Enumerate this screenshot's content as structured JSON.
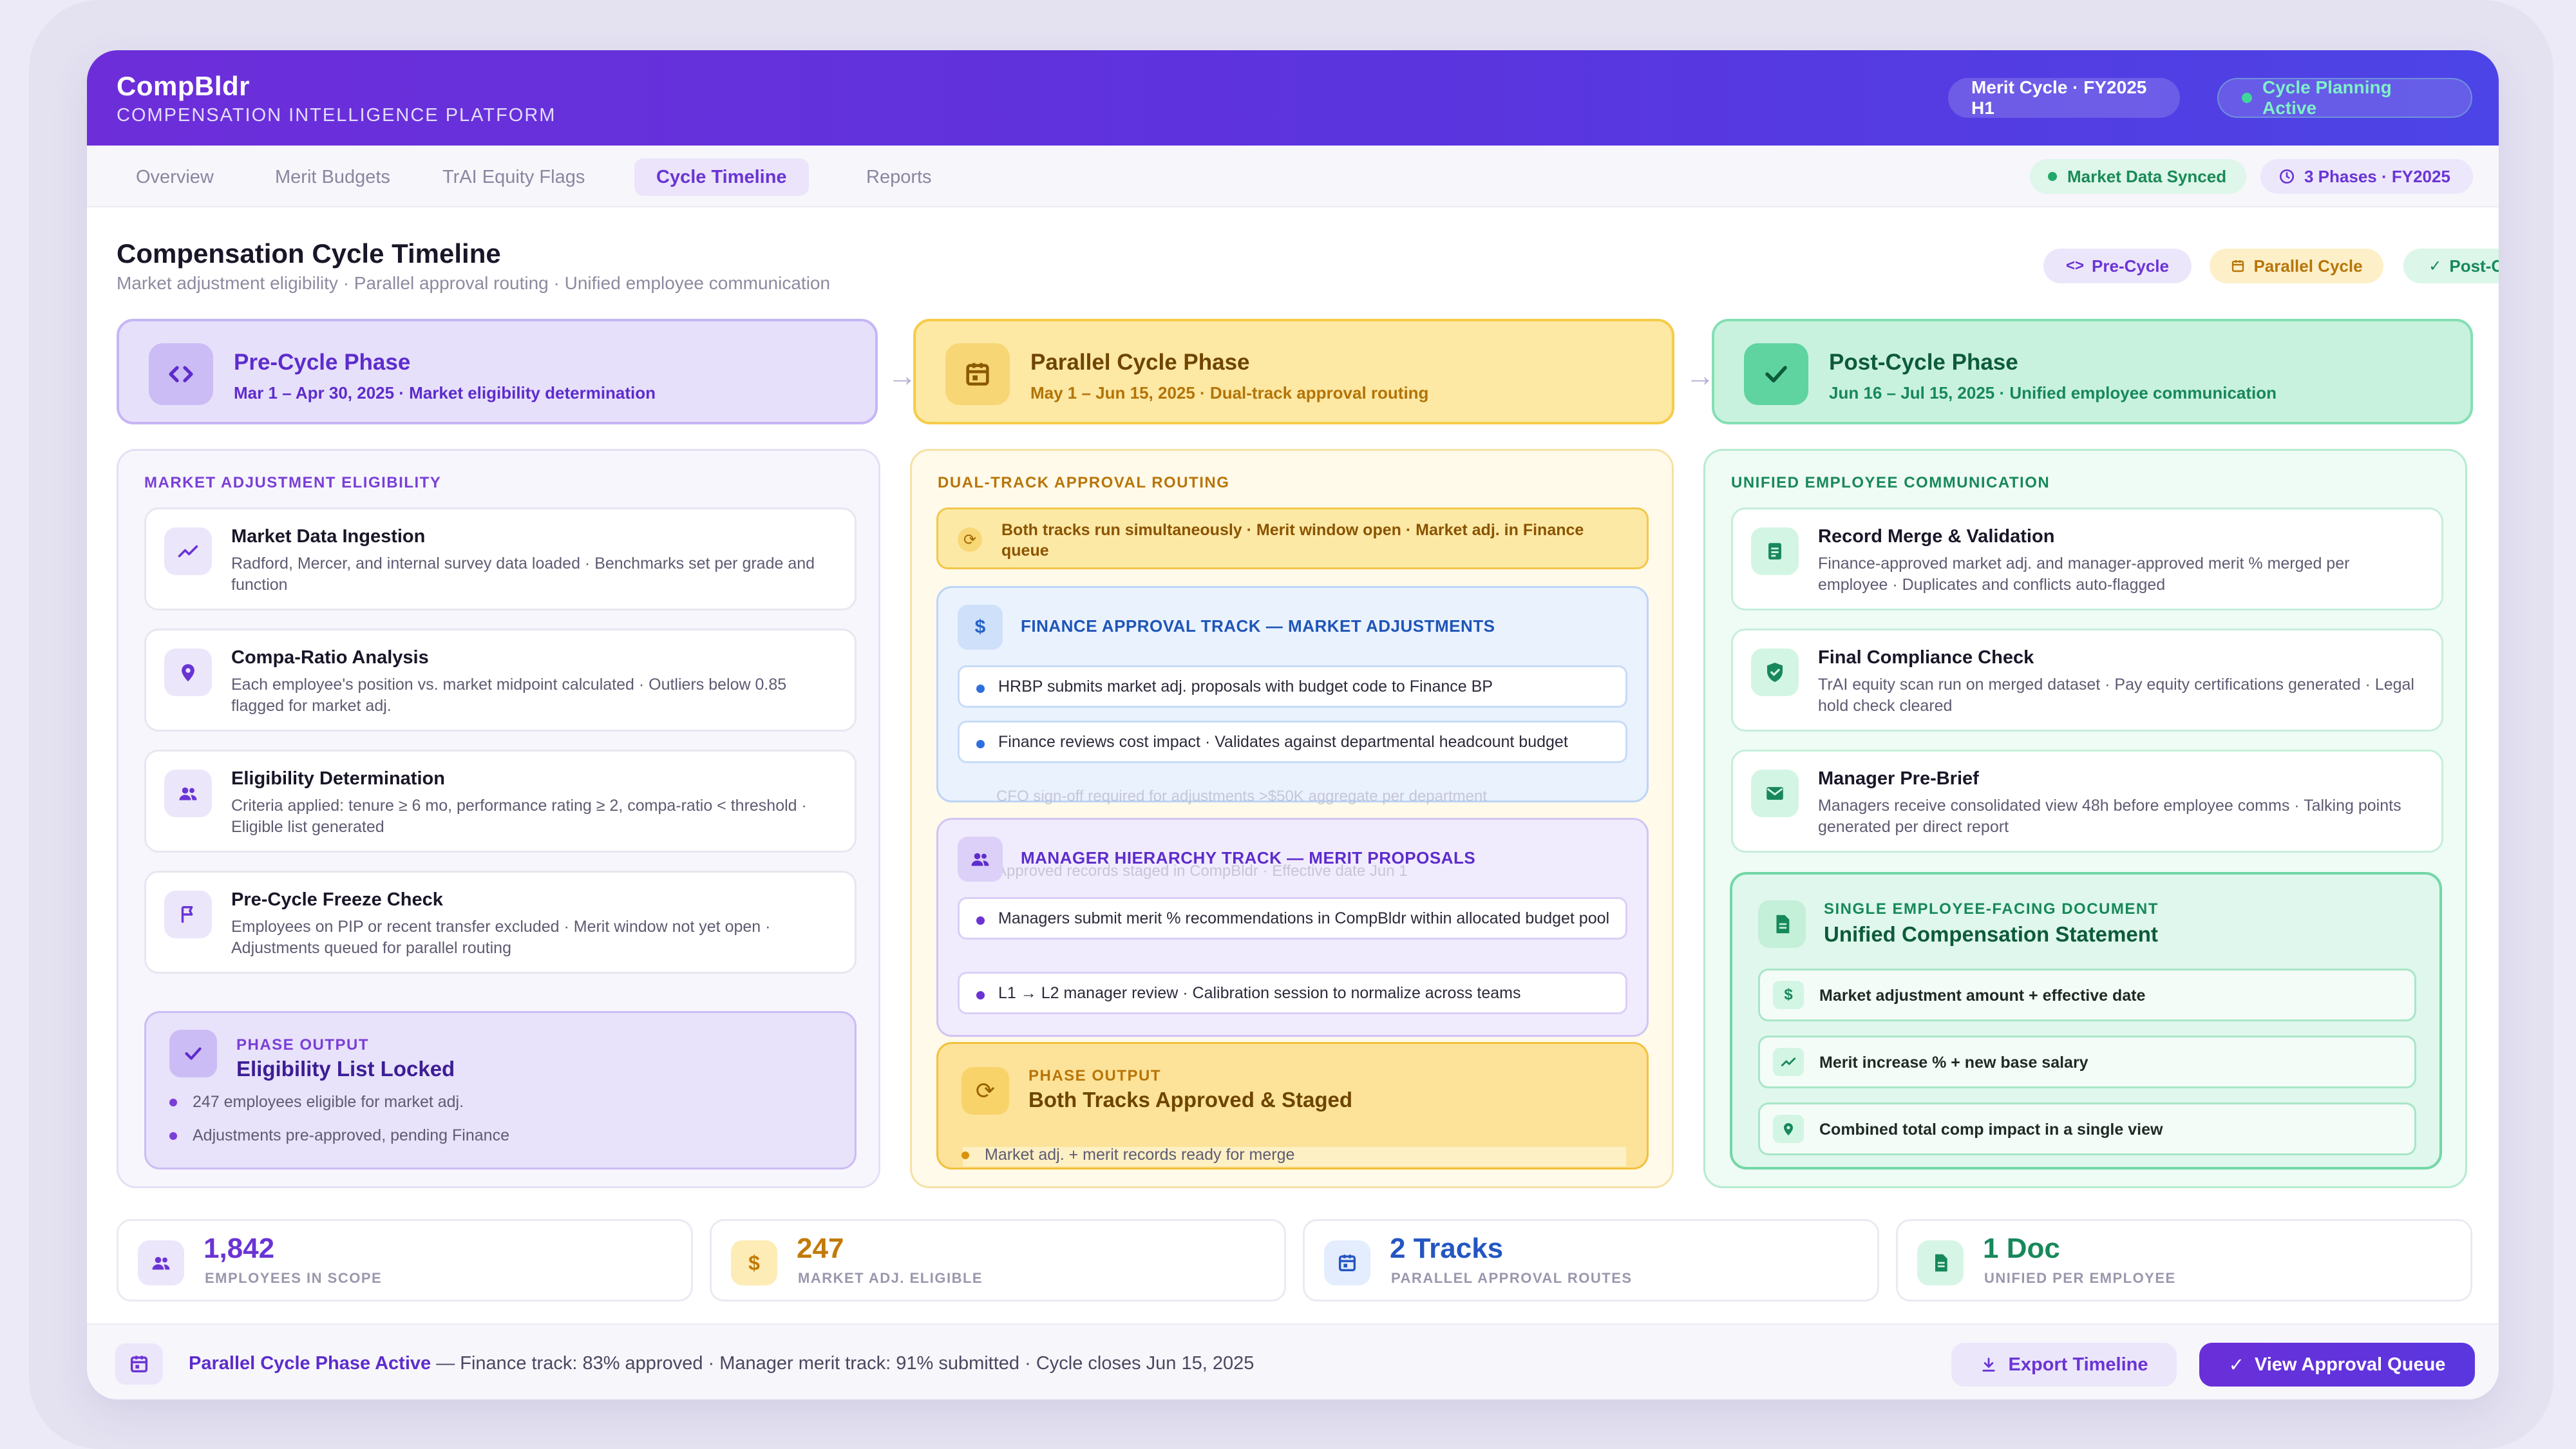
{
  "app": {
    "brand_name": "CompBldr",
    "brand_subtitle": "COMPENSATION INTELLIGENCE PLATFORM",
    "cycle_pill": "Merit Cycle · FY2025 H1",
    "status_pill": "Cycle Planning Active"
  },
  "nav": {
    "tabs": [
      {
        "label": "Overview"
      },
      {
        "label": "Merit Budgets"
      },
      {
        "label": "TrAI Equity Flags"
      },
      {
        "label": "Cycle Timeline"
      },
      {
        "label": "Reports"
      }
    ],
    "active_tab": "Cycle Timeline",
    "market_status": "Market Data Synced",
    "phases_status": "3 Phases · FY2025"
  },
  "page": {
    "title": "Compensation Cycle Timeline",
    "subtitle": "Market adjustment eligibility · Parallel approval routing · Unified employee communication",
    "legend": {
      "pre": "Pre-Cycle",
      "parallel": "Parallel Cycle",
      "post": "Post-Cycle"
    }
  },
  "phases": {
    "pre": {
      "title": "Pre-Cycle Phase",
      "subtitle": "Mar 1 – Apr 30, 2025 · Market eligibility determination"
    },
    "parallel": {
      "title": "Parallel Cycle Phase",
      "subtitle": "May 1 – Jun 15, 2025 · Dual-track approval routing"
    },
    "post": {
      "title": "Post-Cycle Phase",
      "subtitle": "Jun 16 – Jul 15, 2025 · Unified employee communication"
    }
  },
  "pre_column": {
    "label": "MARKET ADJUSTMENT ELIGIBILITY",
    "steps": [
      {
        "title": "Market Data Ingestion",
        "desc": "Radford, Mercer, and internal survey data loaded · Benchmarks set per grade and function"
      },
      {
        "title": "Compa-Ratio Analysis",
        "desc": "Each employee's position vs. market midpoint calculated · Outliers below 0.85 flagged for market adj."
      },
      {
        "title": "Eligibility Determination",
        "desc": "Criteria applied: tenure ≥ 6 mo, performance rating ≥ 2, compa-ratio < threshold · Eligible list generated"
      },
      {
        "title": "Pre-Cycle Freeze Check",
        "desc": "Employees on PIP or recent transfer excluded · Merit window not yet open · Adjustments queued for parallel routing"
      }
    ],
    "output": {
      "label": "PHASE OUTPUT",
      "title": "Eligibility List Locked",
      "bullets": [
        "247 employees eligible for market adj.",
        "Adjustments pre-approved, pending Finance"
      ]
    }
  },
  "parallel_column": {
    "label": "DUAL-TRACK APPROVAL ROUTING",
    "banner": "Both tracks run simultaneously · Merit window open · Market adj. in Finance queue",
    "finance_track": {
      "title": "FINANCE APPROVAL TRACK — MARKET ADJUSTMENTS",
      "items": [
        "HRBP submits market adj. proposals with budget code to Finance BP",
        "Finance reviews cost impact · Validates against departmental headcount budget"
      ],
      "hidden_item": "CFO sign-off required for adjustments >$50K aggregate per department"
    },
    "manager_track": {
      "title": "MANAGER HIERARCHY TRACK — MERIT PROPOSALS",
      "hidden_item": "Approved records staged in CompBldr · Effective date Jun 1",
      "items": [
        "Managers submit merit % recommendations in CompBldr within allocated budget pool",
        "L1 → L2 manager review · Calibration session to normalize across teams"
      ]
    },
    "output": {
      "label": "PHASE OUTPUT",
      "title": "Both Tracks Approved & Staged",
      "bullets": [
        "Market adj. + merit records ready for merge"
      ]
    }
  },
  "post_column": {
    "label": "UNIFIED EMPLOYEE COMMUNICATION",
    "steps": [
      {
        "title": "Record Merge & Validation",
        "desc": "Finance-approved market adj. and manager-approved merit % merged per employee · Duplicates and conflicts auto-flagged"
      },
      {
        "title": "Final Compliance Check",
        "desc": "TrAI equity scan run on merged dataset · Pay equity certifications generated · Legal hold check cleared"
      },
      {
        "title": "Manager Pre-Brief",
        "desc": "Managers receive consolidated view 48h before employee comms · Talking points generated per direct report"
      }
    ],
    "document": {
      "label": "SINGLE EMPLOYEE-FACING DOCUMENT",
      "title": "Unified Compensation Statement",
      "items": [
        "Market adjustment amount + effective date",
        "Merit increase % + new base salary",
        "Combined total comp impact in a single view"
      ]
    }
  },
  "kpis": [
    {
      "value": "1,842",
      "label": "EMPLOYEES IN SCOPE",
      "color": "#6a34d4"
    },
    {
      "value": "247",
      "label": "MARKET ADJ. ELIGIBLE",
      "color": "#c27a06"
    },
    {
      "value": "2 Tracks",
      "label": "PARALLEL APPROVAL ROUTES",
      "color": "#2456c2"
    },
    {
      "value": "1 Doc",
      "label": "UNIFIED PER EMPLOYEE",
      "color": "#17885a"
    }
  ],
  "footer": {
    "status_bold": "Parallel Cycle Phase Active",
    "status_rest": " — Finance track: 83% approved · Manager merit track: 91% submitted · Cycle closes Jun 15, 2025",
    "export_label": "Export Timeline",
    "queue_label": "View Approval Queue"
  },
  "colors": {
    "brand": "#6a34d4",
    "pre": "#6a34d4",
    "parallel": "#d99a0c",
    "post": "#17885a",
    "finance": "#2563c8"
  }
}
